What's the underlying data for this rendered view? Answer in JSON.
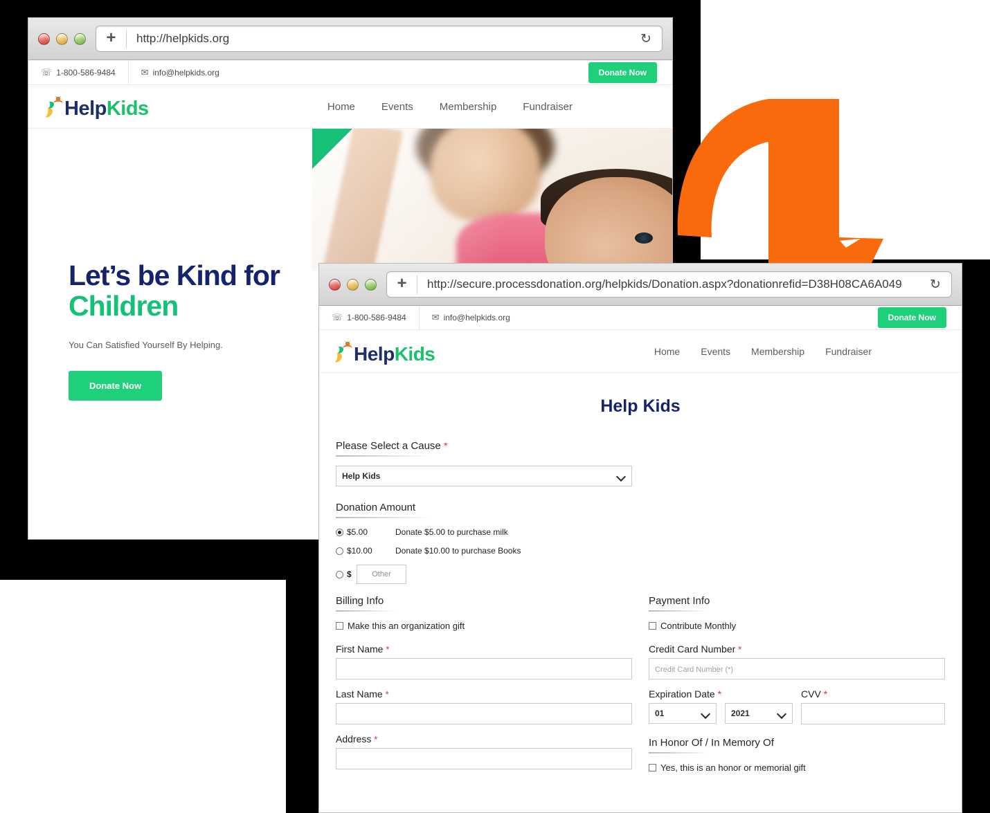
{
  "backdrop_color": "#000000",
  "brand": {
    "name_part1": "Help",
    "name_part2": "Kids",
    "accent_green": "#1fd07a",
    "navy": "#14236b",
    "orange": "#f96a0d"
  },
  "window1": {
    "chrome": {
      "new_tab_label": "+",
      "url": "http://helpkids.org",
      "reload_icon": "reload-icon",
      "close_label": "close",
      "minimize_label": "minimize",
      "maximize_label": "maximize"
    },
    "topbar": {
      "phone": "1-800-586-9484",
      "email": "info@helpkids.org",
      "donate_label": "Donate Now"
    },
    "nav": {
      "items": [
        "Home",
        "Events",
        "Membership",
        "Fundraiser"
      ]
    },
    "hero": {
      "heading_line1": "Let’s be Kind for",
      "heading_line2": "Children",
      "subtitle": "You Can Satisfied Yourself By Helping.",
      "cta_label": "Donate Now"
    }
  },
  "window2": {
    "chrome": {
      "new_tab_label": "+",
      "url": "http://secure.processdonation.org/helpkids/Donation.aspx?donationrefid=D38H08CA6A049",
      "reload_icon": "reload-icon"
    },
    "topbar": {
      "phone": "1-800-586-9484",
      "email": "info@helpkids.org",
      "donate_label": "Donate Now"
    },
    "nav": {
      "items": [
        "Home",
        "Events",
        "Membership",
        "Fundraiser"
      ]
    },
    "form": {
      "title": "Help Kids",
      "cause": {
        "label": "Please Select a Cause",
        "required_marker": "*",
        "selected": "Help Kids",
        "options": [
          "Help Kids"
        ]
      },
      "donation_amount": {
        "label": "Donation Amount",
        "options": [
          {
            "amount": "$5.00",
            "description": "Donate $5.00 to purchase milk",
            "selected": true
          },
          {
            "amount": "$10.00",
            "description": "Donate $10.00 to purchase Books",
            "selected": false
          }
        ],
        "other": {
          "currency_symbol": "$",
          "placeholder": "Other",
          "value": "",
          "selected": false
        }
      },
      "billing": {
        "heading": "Billing Info",
        "org_gift_label": "Make this an organization gift",
        "org_gift_checked": false,
        "first_name_label": "First Name",
        "first_name_value": "",
        "last_name_label": "Last Name",
        "last_name_value": "",
        "address_label": "Address",
        "address_value": "",
        "required_marker": "*"
      },
      "payment": {
        "heading": "Payment Info",
        "monthly_label": "Contribute Monthly",
        "monthly_checked": false,
        "card_label": "Credit Card Number",
        "card_placeholder": "Credit Card Number (*)",
        "card_value": "",
        "expiration_label": "Expiration Date",
        "expiration_month": "01",
        "expiration_year": "2021",
        "month_options": [
          "01"
        ],
        "year_options": [
          "2021"
        ],
        "cvv_label": "CVV",
        "cvv_value": "",
        "required_marker": "*"
      },
      "honor": {
        "heading": "In Honor Of / In Memory Of",
        "checkbox_label": "Yes, this is an honor or memorial gift",
        "checked": false
      }
    }
  },
  "annotation": {
    "arrow_name": "flow-arrow",
    "arrow_color": "#f96a0d"
  }
}
